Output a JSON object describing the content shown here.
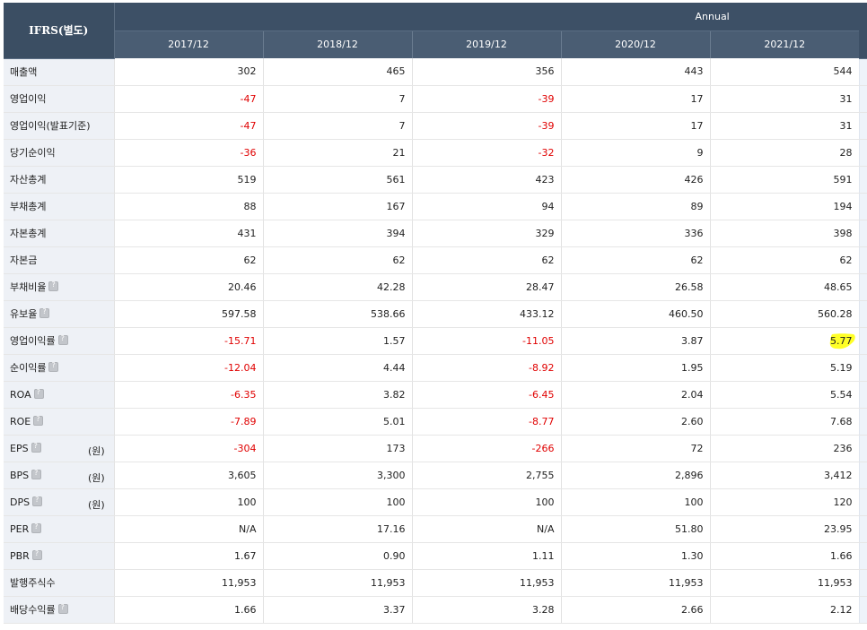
{
  "table": {
    "corner_label": "IFRS(별도)",
    "period_group": "Annual",
    "periods": [
      "2017/12",
      "2018/12",
      "2019/12",
      "2020/12",
      "2021/12"
    ],
    "rows": [
      {
        "label": "매출액",
        "help": false,
        "unit": "",
        "values": [
          "302",
          "465",
          "356",
          "443",
          "544"
        ]
      },
      {
        "label": "영업이익",
        "help": false,
        "unit": "",
        "values": [
          "-47",
          "7",
          "-39",
          "17",
          "31"
        ]
      },
      {
        "label": "영업이익(발표기준)",
        "help": false,
        "unit": "",
        "values": [
          "-47",
          "7",
          "-39",
          "17",
          "31"
        ]
      },
      {
        "label": "당기순이익",
        "help": false,
        "unit": "",
        "values": [
          "-36",
          "21",
          "-32",
          "9",
          "28"
        ]
      },
      {
        "label": "자산총계",
        "help": false,
        "unit": "",
        "values": [
          "519",
          "561",
          "423",
          "426",
          "591"
        ]
      },
      {
        "label": "부채총계",
        "help": false,
        "unit": "",
        "values": [
          "88",
          "167",
          "94",
          "89",
          "194"
        ]
      },
      {
        "label": "자본총계",
        "help": false,
        "unit": "",
        "values": [
          "431",
          "394",
          "329",
          "336",
          "398"
        ]
      },
      {
        "label": "자본금",
        "help": false,
        "unit": "",
        "values": [
          "62",
          "62",
          "62",
          "62",
          "62"
        ]
      },
      {
        "label": "부채비율",
        "help": true,
        "unit": "",
        "values": [
          "20.46",
          "42.28",
          "28.47",
          "26.58",
          "48.65"
        ]
      },
      {
        "label": "유보율",
        "help": true,
        "unit": "",
        "values": [
          "597.58",
          "538.66",
          "433.12",
          "460.50",
          "560.28"
        ]
      },
      {
        "label": "영업이익률",
        "help": true,
        "unit": "",
        "values": [
          "-15.71",
          "1.57",
          "-11.05",
          "3.87",
          "5.77"
        ]
      },
      {
        "label": "순이익률",
        "help": true,
        "unit": "",
        "values": [
          "-12.04",
          "4.44",
          "-8.92",
          "1.95",
          "5.19"
        ]
      },
      {
        "label": "ROA",
        "help": true,
        "unit": "",
        "values": [
          "-6.35",
          "3.82",
          "-6.45",
          "2.04",
          "5.54"
        ]
      },
      {
        "label": "ROE",
        "help": true,
        "unit": "",
        "values": [
          "-7.89",
          "5.01",
          "-8.77",
          "2.60",
          "7.68"
        ]
      },
      {
        "label": "EPS",
        "help": true,
        "unit": "(원)",
        "values": [
          "-304",
          "173",
          "-266",
          "72",
          "236"
        ]
      },
      {
        "label": "BPS",
        "help": true,
        "unit": "(원)",
        "values": [
          "3,605",
          "3,300",
          "2,755",
          "2,896",
          "3,412"
        ]
      },
      {
        "label": "DPS",
        "help": true,
        "unit": "(원)",
        "values": [
          "100",
          "100",
          "100",
          "100",
          "120"
        ]
      },
      {
        "label": "PER",
        "help": true,
        "unit": "",
        "values": [
          "N/A",
          "17.16",
          "N/A",
          "51.80",
          "23.95"
        ]
      },
      {
        "label": "PBR",
        "help": true,
        "unit": "",
        "values": [
          "1.67",
          "0.90",
          "1.11",
          "1.30",
          "1.66"
        ]
      },
      {
        "label": "발행주식수",
        "help": false,
        "unit": "",
        "values": [
          "11,953",
          "11,953",
          "11,953",
          "11,953",
          "11,953"
        ]
      },
      {
        "label": "배당수익률",
        "help": true,
        "unit": "",
        "values": [
          "1.66",
          "3.37",
          "3.28",
          "2.66",
          "2.12"
        ]
      }
    ]
  },
  "annotation": {
    "row": 10,
    "col": 4,
    "color": "#ffff00"
  },
  "colors": {
    "header_bg": "#3d5066",
    "negative": "#e00000",
    "label_bg": "#eef1f6"
  }
}
